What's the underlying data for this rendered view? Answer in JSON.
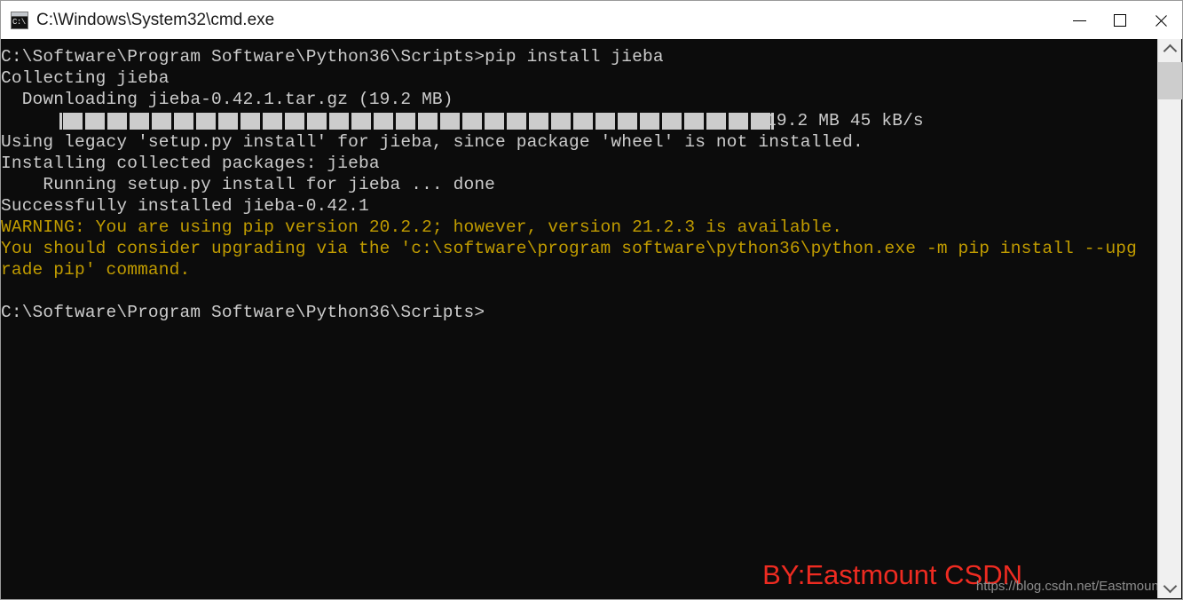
{
  "window": {
    "title": "C:\\Windows\\System32\\cmd.exe",
    "icon": "cmd-icon",
    "icon_text": "C:\\",
    "background_color": "#0c0c0c",
    "text_color": "#cccccc",
    "warning_color": "#c19c00"
  },
  "titlebar_buttons": {
    "minimize": "minimize-button",
    "maximize": "maximize-button",
    "close": "close-button"
  },
  "console": {
    "lines": [
      {
        "text": "C:\\Software\\Program Software\\Python36\\Scripts>pip install jieba",
        "style": "normal"
      },
      {
        "text": "Collecting jieba",
        "style": "normal"
      },
      {
        "text": "  Downloading jieba-0.42.1.tar.gz (19.2 MB)",
        "style": "normal"
      },
      {
        "text": "",
        "style": "progress"
      },
      {
        "text": "Using legacy 'setup.py install' for jieba, since package 'wheel' is not installed.",
        "style": "normal"
      },
      {
        "text": "Installing collected packages: jieba",
        "style": "normal"
      },
      {
        "text": "    Running setup.py install for jieba ... done",
        "style": "normal"
      },
      {
        "text": "Successfully installed jieba-0.42.1",
        "style": "normal"
      },
      {
        "text": "WARNING: You are using pip version 20.2.2; however, version 21.2.3 is available.",
        "style": "warn"
      },
      {
        "text": "You should consider upgrading via the 'c:\\software\\program software\\python36\\python.exe -m pip install --upg",
        "style": "warn"
      },
      {
        "text": "rade pip' command.",
        "style": "warn"
      },
      {
        "text": "",
        "style": "blank"
      },
      {
        "text": "C:\\Software\\Program Software\\Python36\\Scripts>",
        "style": "normal"
      }
    ],
    "progress": {
      "blocks": 32,
      "label": "19.2 MB 45 kB/s",
      "size": "19.2 MB",
      "speed": "45 kB/s",
      "percent": 100,
      "fill_color": "#cccccc"
    }
  },
  "watermarks": {
    "main": "BY:Eastmount CSDN",
    "main_color": "#ee2b21",
    "url": "https://blog.csdn.net/Eastmount"
  },
  "scrollbar": {
    "up_arrow": "chevron-up-icon",
    "down_arrow": "chevron-down-icon",
    "thumb_position_percent": 4
  }
}
